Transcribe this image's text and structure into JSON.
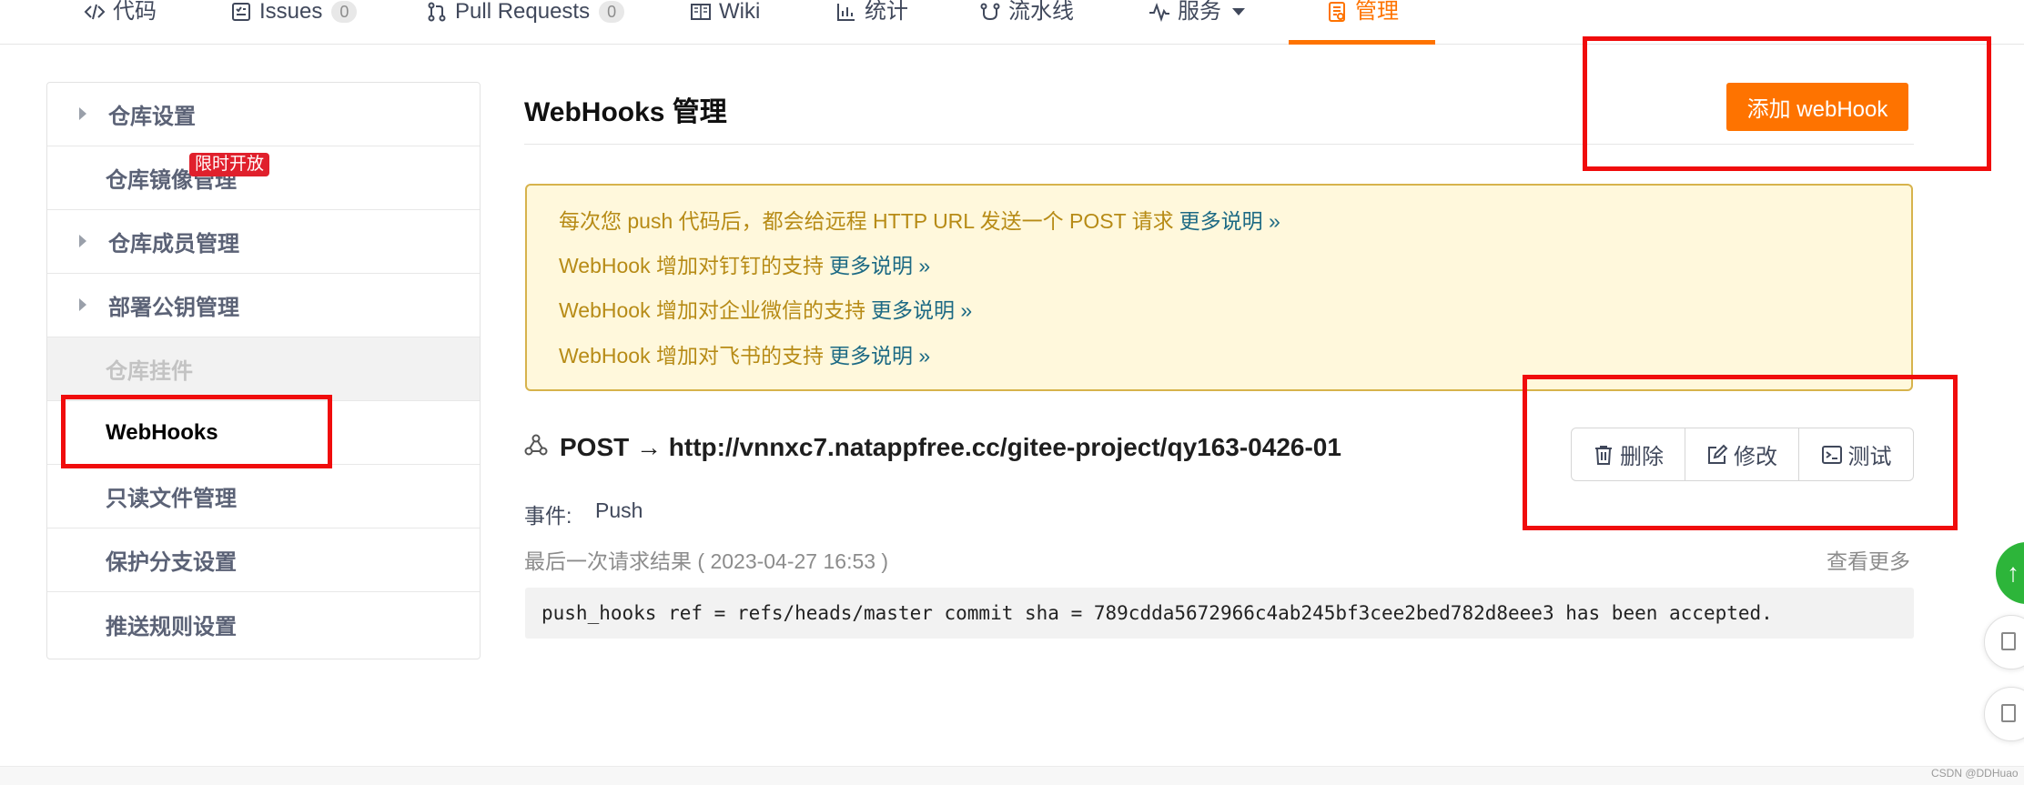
{
  "nav": {
    "tabs": [
      {
        "label": "代码",
        "icon": "code-icon"
      },
      {
        "label": "Issues",
        "icon": "issues-icon",
        "badge": "0"
      },
      {
        "label": "Pull Requests",
        "icon": "pull-request-icon",
        "badge": "0"
      },
      {
        "label": "Wiki",
        "icon": "book-icon"
      },
      {
        "label": "统计",
        "icon": "bar-chart-icon"
      },
      {
        "label": "流水线",
        "icon": "pipeline-icon"
      },
      {
        "label": "服务",
        "icon": "pulse-icon"
      },
      {
        "label": "管理",
        "icon": "manage-icon",
        "active": true
      }
    ]
  },
  "sidebar": {
    "items": [
      {
        "label": "仓库设置",
        "expandable": true
      },
      {
        "label": "仓库镜像管理",
        "badge": "限时开放"
      },
      {
        "label": "仓库成员管理",
        "expandable": true
      },
      {
        "label": "部署公钥管理",
        "expandable": true
      },
      {
        "label": "仓库挂件",
        "disabled": true
      },
      {
        "label": "WebHooks",
        "active": true
      },
      {
        "label": "只读文件管理"
      },
      {
        "label": "保护分支设置"
      },
      {
        "label": "推送规则设置"
      }
    ]
  },
  "main": {
    "title": "WebHooks 管理",
    "add_button": "添加 webHook",
    "notice": [
      {
        "text": "每次您 push 代码后，都会给远程 HTTP URL 发送一个 POST 请求",
        "more": "更多说明 »"
      },
      {
        "text": "WebHook 增加对钉钉的支持",
        "more": "更多说明 »"
      },
      {
        "text": "WebHook 增加对企业微信的支持",
        "more": "更多说明 »"
      },
      {
        "text": "WebHook 增加对飞书的支持",
        "more": "更多说明 »"
      }
    ],
    "hook": {
      "url_line": "POST → http://vnnxc7.natappfree.cc/gitee-project/qy163-0426-01",
      "buttons": {
        "delete": "删除",
        "edit": "修改",
        "test": "测试"
      },
      "event_label": "事件:",
      "event_value": "Push",
      "last_result": "最后一次请求结果 ( 2023-04-27 16:53 )",
      "view_more": "查看更多",
      "log": "push_hooks ref = refs/heads/master commit sha = 789cdda5672966c4ab245bf3cee2bed782d8eee3 has been accepted."
    }
  },
  "watermark": "CSDN @DDHuao",
  "colors": {
    "accent": "#fe7300",
    "highlight": "#f00c0c",
    "notice_bg": "#fff8dc",
    "notice_text": "#b78b16",
    "link": "#1d6a84"
  }
}
